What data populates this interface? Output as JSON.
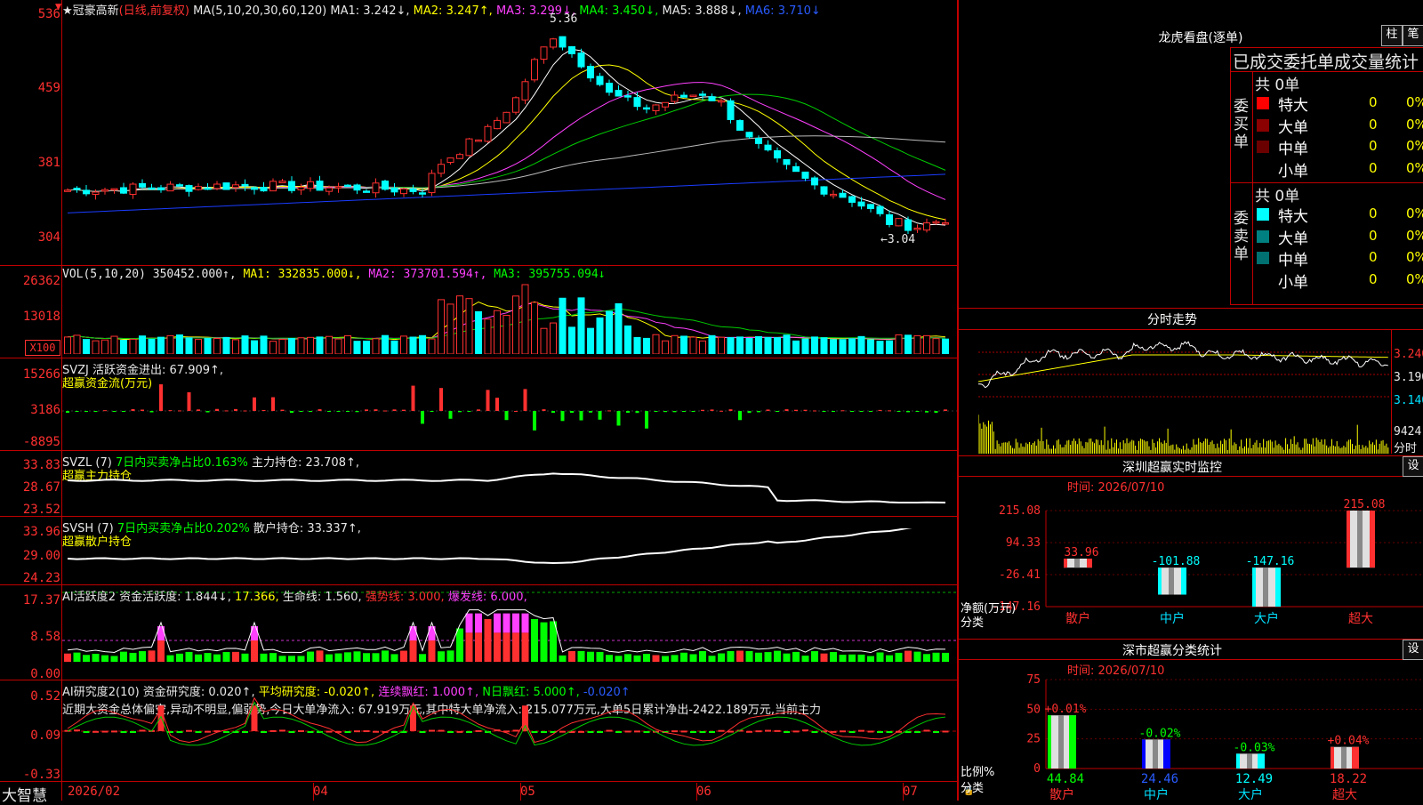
{
  "colors": {
    "up": "#ff3030",
    "down": "#00ffff",
    "ma1": "#ffffff",
    "ma2": "#ffff00",
    "ma3": "#ff40ff",
    "ma4": "#00cc00",
    "ma5": "#bbbbbb",
    "ma6": "#1a3cff",
    "frame": "#c00000"
  },
  "kline": {
    "stock_name": "★冠豪高新",
    "mode": "(日线,前复权)",
    "ma_label": "MA(5,10,20,30,60,120)",
    "ma1": "MA1: 3.242↓,",
    "ma2": "MA2: 3.247↑,",
    "ma3": "MA3: 3.299↓,",
    "ma4": "MA4: 3.450↓,",
    "ma5": "MA5: 3.888↓,",
    "ma6": "MA6: 3.710↓",
    "high_mark": "5.36",
    "low_mark": "←3.04",
    "y_ticks": [
      "536",
      "459",
      "381",
      "304"
    ],
    "top_left_icon": "red-arrow-icon"
  },
  "volume": {
    "label": "VOL(5,10,20)",
    "value": "350452.000↑,",
    "ma1": "MA1: 332835.000↓,",
    "ma2": "MA2: 373701.594↑,",
    "ma3": "MA3: 395755.094↓",
    "y_ticks": [
      "26362",
      "13018"
    ],
    "unit": "X100"
  },
  "svzj": {
    "label": "SVZJ  活跃资金进出: 67.909↑,",
    "subtitle": "超赢资金流(万元)",
    "y_ticks": [
      "15266",
      "3186",
      "-8895"
    ]
  },
  "svzl": {
    "label_a": "SVZL (7)",
    "label_b": "7日内买卖净占比0.163%",
    "label_c": "主力持仓: 23.708↑,",
    "subtitle": "超赢主力持仓",
    "y_ticks": [
      "33.83",
      "28.67",
      "23.52"
    ]
  },
  "svsh": {
    "label_a": "SVSH (7)",
    "label_b": "7日内买卖净占比0.202%",
    "label_c": "散户持仓: 33.337↑,",
    "subtitle": "超赢散户持仓",
    "y_ticks": [
      "33.96",
      "29.00",
      "24.23"
    ]
  },
  "ai_active": {
    "label_a": "AI活跃度2",
    "label_b": "资金活跃度: 1.844↓,",
    "label_c": "17.366,",
    "label_d": "生命线: 1.560,",
    "label_e": "强势线: 3.000,",
    "label_f": "爆发线: 6.000,",
    "y_ticks": [
      "17.37",
      "8.58",
      "0.00"
    ]
  },
  "ai_research": {
    "label_a": "AI研究度2(10)",
    "label_b": "资金研究度: 0.020↑,",
    "label_c": "平均研究度: -0.020↑,",
    "label_d": "连续飘红: 1.000↑,",
    "label_e": "N日飘红: 5.000↑,",
    "label_f": "-0.020↑",
    "summary": "近期大资金总体偏空,异动不明显,偏弱势,今日大单净流入: 67.919万元,其中特大单净流入: 215.077万元,大单5日累计净出-2422.189万元,当前主力",
    "y_ticks": [
      "0.52",
      "0.09",
      "-0.33"
    ]
  },
  "xaxis": {
    "brand": "大智慧",
    "labels": [
      "2026/02",
      "04",
      "05",
      "06",
      "07"
    ]
  },
  "right": {
    "dragon_title": "龙虎看盘(逐单)",
    "btn_bar": "柱",
    "btn_stroke": "笔",
    "stats_header": "已成交委托单成交量统计",
    "buy_label": "委买单",
    "sell_label": "委卖单",
    "buy_total": "共 0单",
    "sell_total": "共 0单",
    "buy_rows": [
      {
        "name": "特大",
        "count": "0",
        "pct": "0%",
        "color": "#ff0000"
      },
      {
        "name": "大单",
        "count": "0",
        "pct": "0%",
        "color": "#8b0000"
      },
      {
        "name": "中单",
        "count": "0",
        "pct": "0%",
        "color": "#6b0000"
      },
      {
        "name": "小单",
        "count": "0",
        "pct": "0%",
        "color": ""
      }
    ],
    "sell_rows": [
      {
        "name": "特大",
        "count": "0",
        "pct": "0%",
        "color": "#00ffff"
      },
      {
        "name": "大单",
        "count": "0",
        "pct": "0%",
        "color": "#008080"
      },
      {
        "name": "中单",
        "count": "0",
        "pct": "0%",
        "color": "#007070"
      },
      {
        "name": "小单",
        "count": "0",
        "pct": "0%",
        "color": ""
      }
    ],
    "intraday_title": "分时走势",
    "intraday_ticks": [
      "3.240",
      "3.190",
      "3.140"
    ],
    "intraday_vol": "9424",
    "intraday_unit": "分时",
    "sz_title": "深圳超赢实时监控",
    "sz_btn": "设",
    "sz_time": "时间: 2026/07/10",
    "sz_y_ticks": [
      "215.08",
      "94.33",
      "-26.41",
      "-147.16"
    ],
    "sz_ylabel": "净额(万元)",
    "sz_xlabel": "分类",
    "sz_cats": [
      "散户",
      "中户",
      "大户",
      "超大"
    ],
    "sz_values": [
      "33.96",
      "-101.88",
      "-147.16",
      "215.08"
    ],
    "cls_title": "深市超赢分类统计",
    "cls_btn": "设",
    "cls_time": "时间: 2026/07/10",
    "cls_y_ticks": [
      "75",
      "50",
      "25",
      "0"
    ],
    "cls_ylabel": "比例%",
    "cls_xlabel": "分类",
    "cls_cats": [
      "散户",
      "中户",
      "大户",
      "超大"
    ],
    "cls_changes": [
      "+0.01%",
      "-0.02%",
      "-0.03%",
      "+0.04%"
    ],
    "cls_values": [
      "44.84",
      "24.46",
      "12.49",
      "18.22"
    ]
  }
}
